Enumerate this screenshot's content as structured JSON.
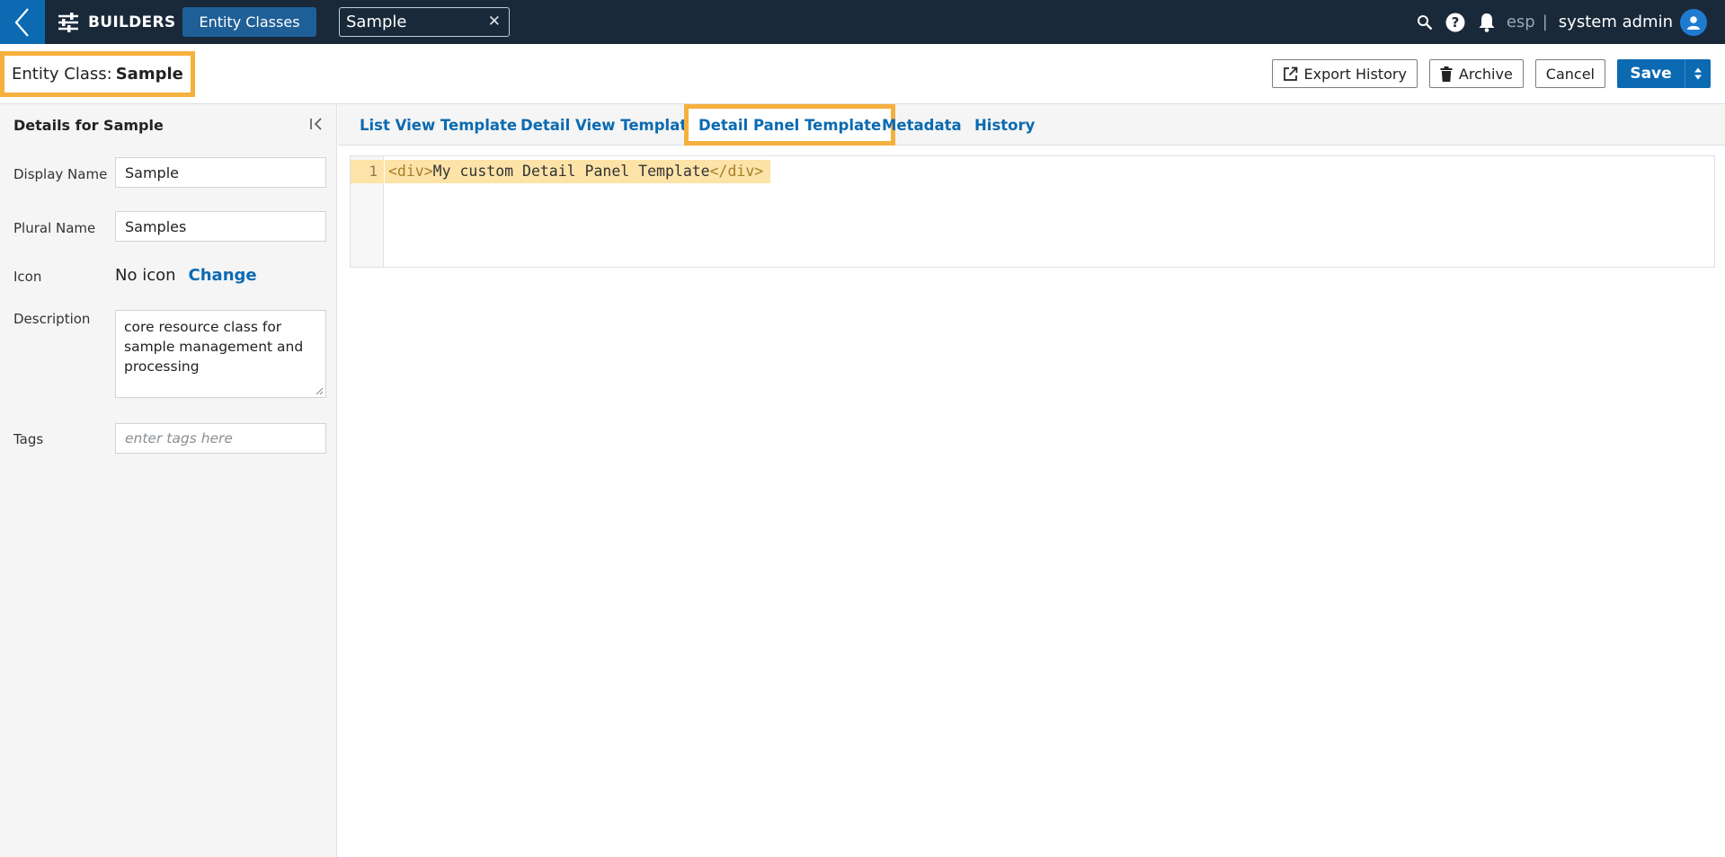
{
  "nav": {
    "section_label": "BUILDERS",
    "entity_classes_label": "Entity Classes",
    "open_tab_label": "Sample",
    "org": "esp",
    "separator": "|",
    "user_name": "system admin"
  },
  "header": {
    "title_prefix": "Entity Class:",
    "title_name": "Sample",
    "export_history_label": "Export History",
    "archive_label": "Archive",
    "cancel_label": "Cancel",
    "save_label": "Save"
  },
  "sidebar": {
    "title": "Details for Sample",
    "display_name_label": "Display Name",
    "display_name_value": "Sample",
    "plural_name_label": "Plural Name",
    "plural_name_value": "Samples",
    "icon_label": "Icon",
    "icon_value": "No icon",
    "icon_change_label": "Change",
    "description_label": "Description",
    "description_value": "core resource class for sample management and processing",
    "tags_label": "Tags",
    "tags_placeholder": "enter tags here"
  },
  "tabs": [
    {
      "label": "List View Template",
      "active": false
    },
    {
      "label": "Detail View Template",
      "active": false
    },
    {
      "label": "Detail Panel Template",
      "active": true
    },
    {
      "label": "Metadata",
      "active": false
    },
    {
      "label": "History",
      "active": false
    }
  ],
  "editor": {
    "line_number": "1",
    "code_open_tag": "<div>",
    "code_text": "My custom Detail Panel Template",
    "code_close_tag": "</div>"
  },
  "colors": {
    "nav_bg": "#19293a",
    "accent_blue": "#0b6ab2",
    "highlight_orange": "#f6b03e",
    "code_highlight": "#fde3a8"
  }
}
